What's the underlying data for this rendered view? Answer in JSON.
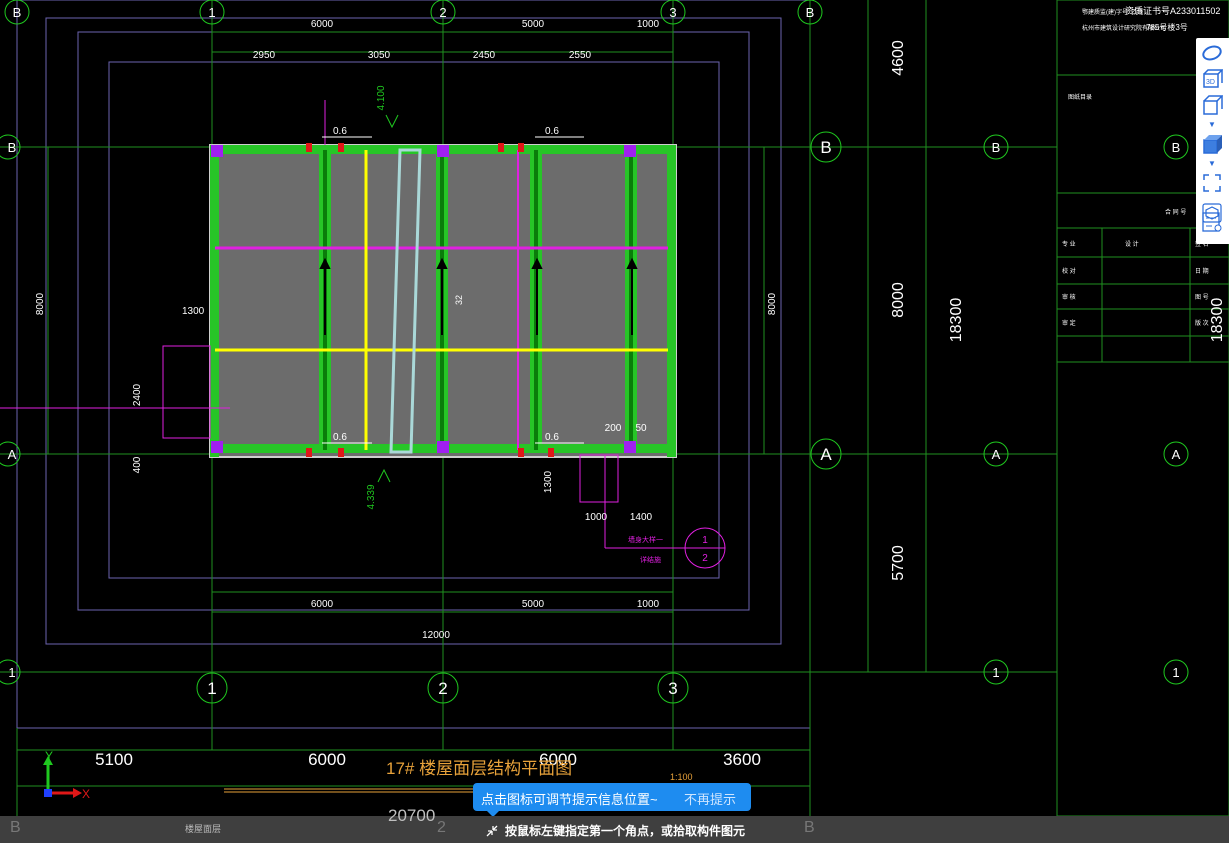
{
  "drawing": {
    "title": "17# 楼屋面层结构平面图",
    "scale": "1:100",
    "grid_labels": {
      "col1": "1",
      "col2": "2",
      "col3": "3",
      "rowA": "A",
      "rowB": "B"
    },
    "top_dims_row1": [
      "6000",
      "5000",
      "1000"
    ],
    "top_dims_row2": [
      "2950",
      "3050",
      "2450",
      "2550"
    ],
    "bottom_dims": [
      "6000",
      "5000",
      "1000"
    ],
    "bottom_total": "12000",
    "left_span": "8000",
    "right_span": "8000",
    "right_dims": [
      "4600",
      "8000",
      "5700"
    ],
    "right_total": "18300",
    "lower_dims": [
      "5100",
      "6000",
      "6000",
      "3600"
    ],
    "lower_total": "20700",
    "annotations": {
      "elev_top": "4.100",
      "elev_bottom": "4.339",
      "stair_w": "1300",
      "stair_h": "2400",
      "dim_400": "400",
      "dim_200": "200",
      "dim_50": "50",
      "dim_1300b": "1300",
      "dim_1000": "1000",
      "dim_1400": "1400",
      "slab_note": "0.6",
      "detail_top": "1",
      "detail_bottom": "2",
      "slab_mark": "32",
      "leader_text1": "墙身大样一",
      "leader_text2": "详结施"
    },
    "title_block": {
      "line1": "鄂建质监(建)字号: 乙级",
      "line2": "资质证书号A233011502",
      "line3": "杭州市建筑设计研究院有限公司",
      "line4": "785号楼3号",
      "section": "图纸目录",
      "note": "合 同 号",
      "rows": [
        {
          "a": "专 业",
          "b": "设 计",
          "c": "签 名"
        },
        {
          "a": "校 对",
          "b": "",
          "c": "日 期"
        },
        {
          "a": "审 核",
          "b": "",
          "c": "图 号"
        },
        {
          "a": "审 定",
          "b": "",
          "c": "版 次"
        }
      ]
    }
  },
  "view_axis": {
    "x": "X",
    "y": "Y"
  },
  "toolbar": {
    "buttons": [
      "ellipse-icon",
      "3d-icon",
      "cube-outline-icon",
      "cube-solid-icon",
      "fullscreen-icon",
      "component-icon",
      "property-icon"
    ]
  },
  "tooltip": {
    "text": "点击图标可调节提示信息位置~",
    "dismiss": "不再提示"
  },
  "status": {
    "prompt": "按鼠标左键指定第一个角点，或拾取构件图元",
    "layer_label": "楼屋面层",
    "bottom_total": "20700"
  },
  "colors": {
    "green": "#22c822",
    "magenta": "#e020e0",
    "yellow": "#ffff00",
    "slab": "#6c6c6c",
    "cyan": "#aad8d8"
  }
}
